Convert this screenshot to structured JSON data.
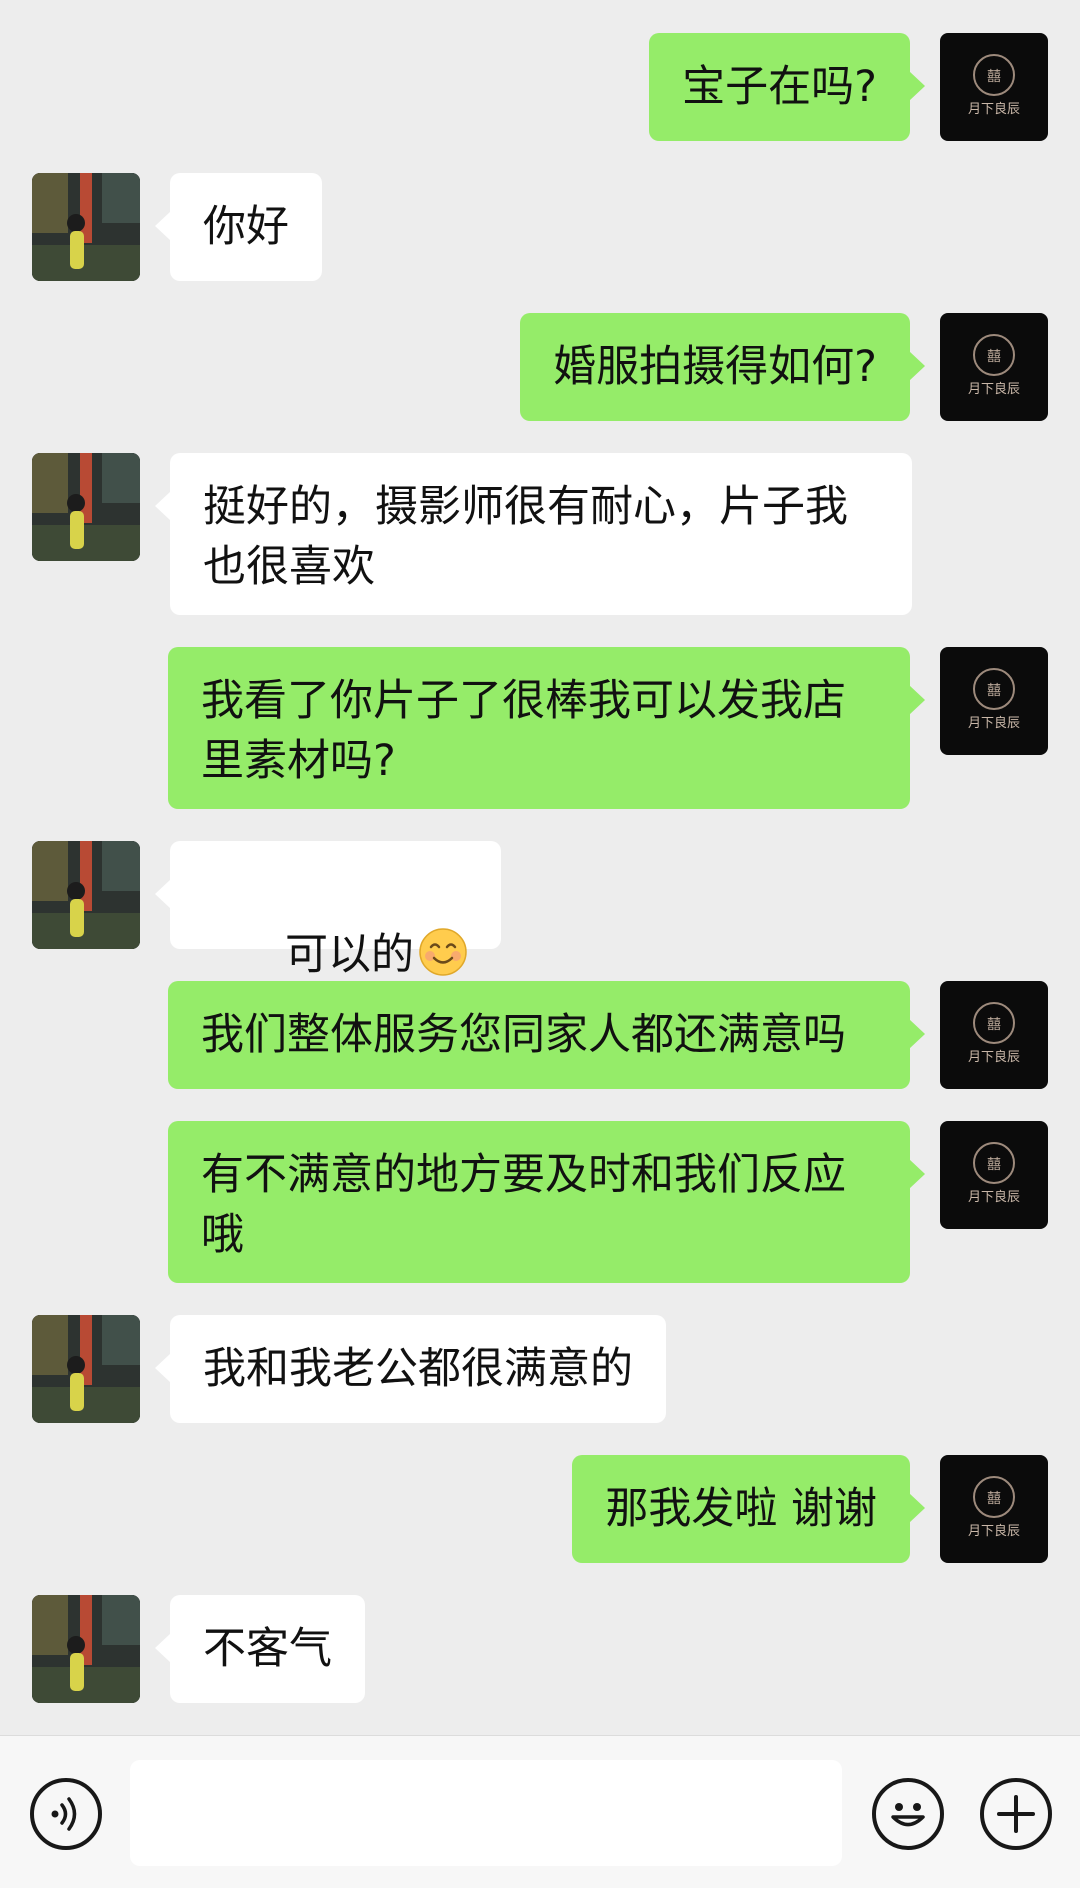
{
  "messages": [
    {
      "side": "right",
      "text": "宝子在吗?"
    },
    {
      "side": "left",
      "text": "你好"
    },
    {
      "side": "right",
      "text": "婚服拍摄得如何?"
    },
    {
      "side": "left",
      "text": "挺好的，摄影师很有耐心，片子我\n也很喜欢"
    },
    {
      "side": "right",
      "text": "我看了你片子了很棒我可以发我店\n里素材吗?"
    },
    {
      "side": "left",
      "text": "可以的",
      "emoji": "smiling-face"
    },
    {
      "side": "right",
      "text": "我们整体服务您同家人都还满意吗"
    },
    {
      "side": "right",
      "text": "有不满意的地方要及时和我们反应\n哦"
    },
    {
      "side": "left",
      "text": "我和我老公都很满意的"
    },
    {
      "side": "right",
      "text": "那我发啦 谢谢"
    },
    {
      "side": "left",
      "text": "不客气"
    }
  ],
  "shop_avatar": {
    "logo_text": "月下良辰"
  },
  "input_bar": {
    "voice_icon": "voice-icon",
    "emoji_icon": "emoji-icon",
    "add_icon": "plus-icon",
    "value": ""
  },
  "colors": {
    "sent_bubble": "#95ec69",
    "received_bubble": "#ffffff",
    "background": "#ededed"
  }
}
